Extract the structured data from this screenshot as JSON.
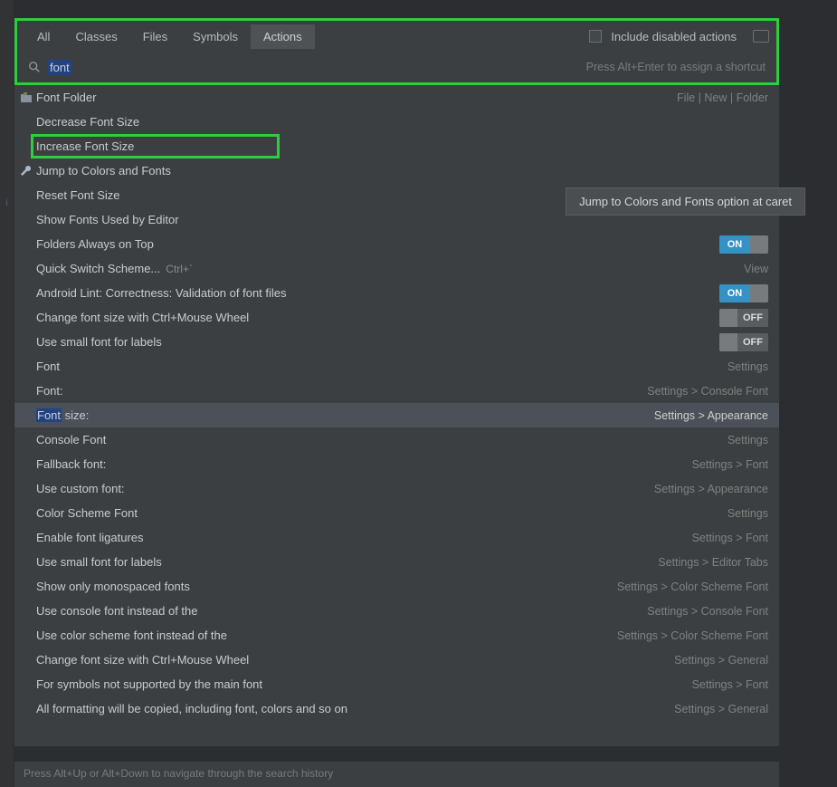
{
  "tabs": [
    "All",
    "Classes",
    "Files",
    "Symbols",
    "Actions"
  ],
  "activeTabIndex": 4,
  "includeDisabled": "Include disabled actions",
  "search": {
    "value": "font",
    "hint": "Press Alt+Enter to assign a shortcut"
  },
  "tooltip": "Jump to Colors and Fonts option at caret",
  "footerHint": "Press Alt+Up or Alt+Down to navigate through the search history",
  "toggleOn": "ON",
  "toggleOff": "OFF",
  "rows": [
    {
      "icon": "folder",
      "label": "Font Folder",
      "right": "File | New | Folder"
    },
    {
      "label": "Decrease Font Size"
    },
    {
      "label": "Increase Font Size",
      "greenBox": true
    },
    {
      "icon": "wrench",
      "label": "Jump to Colors and Fonts"
    },
    {
      "label": "Reset Font Size"
    },
    {
      "label": "Show Fonts Used by Editor"
    },
    {
      "label": "Folders Always on Top",
      "toggle": "on"
    },
    {
      "label": "Quick Switch Scheme...",
      "kbd": "Ctrl+`",
      "right": "View"
    },
    {
      "label": "Android Lint: Correctness: Validation of font files",
      "toggle": "on"
    },
    {
      "label": "Change font size with Ctrl+Mouse Wheel",
      "toggle": "off"
    },
    {
      "label": "Use small font for labels",
      "toggle": "off"
    },
    {
      "label": "Font",
      "right": "Settings"
    },
    {
      "label": "Font:",
      "right": "Settings > Console Font"
    },
    {
      "label": "Font size:",
      "right": "Settings > Appearance",
      "selected": true,
      "hl": "Font"
    },
    {
      "label": "Console Font",
      "right": "Settings"
    },
    {
      "label": "Fallback font:",
      "right": "Settings > Font"
    },
    {
      "label": "Use custom font:",
      "right": "Settings > Appearance"
    },
    {
      "label": "Color Scheme Font",
      "right": "Settings"
    },
    {
      "label": "Enable font ligatures",
      "right": "Settings > Font"
    },
    {
      "label": "Use small font for labels",
      "right": "Settings > Editor Tabs"
    },
    {
      "label": "Show only monospaced fonts",
      "right": "Settings > Color Scheme Font"
    },
    {
      "label": "Use console font instead of the",
      "right": "Settings > Console Font"
    },
    {
      "label": "Use color scheme font instead of the",
      "right": "Settings > Color Scheme Font"
    },
    {
      "label": "Change font size with Ctrl+Mouse Wheel",
      "right": "Settings > General"
    },
    {
      "label": "For symbols not supported by the main font",
      "right": "Settings > Font"
    },
    {
      "label": "All formatting will be copied, including font, colors and so on",
      "right": "Settings > General"
    }
  ]
}
